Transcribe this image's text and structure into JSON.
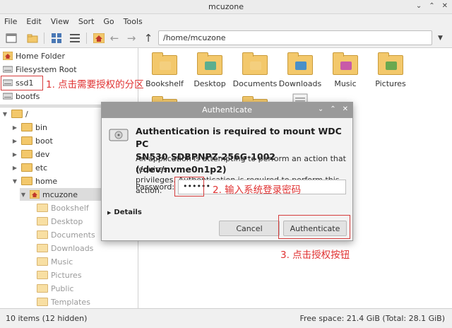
{
  "window": {
    "title": "mcuzone"
  },
  "menu": [
    "File",
    "Edit",
    "View",
    "Sort",
    "Go",
    "Tools"
  ],
  "path": "/home/mcuzone",
  "places": [
    {
      "label": "Home Folder",
      "icon": "home-icon"
    },
    {
      "label": "Filesystem Root",
      "icon": "drive-icon"
    },
    {
      "label": "ssd1",
      "icon": "drive-icon"
    },
    {
      "label": "bootfs",
      "icon": "drive-icon"
    }
  ],
  "tree": [
    {
      "label": "/",
      "level": 0
    },
    {
      "label": "bin",
      "level": 1
    },
    {
      "label": "boot",
      "level": 1
    },
    {
      "label": "dev",
      "level": 1
    },
    {
      "label": "etc",
      "level": 1
    },
    {
      "label": "home",
      "level": 1
    },
    {
      "label": "mcuzone",
      "level": 2
    },
    {
      "label": "Bookshelf",
      "level": 3
    },
    {
      "label": "Desktop",
      "level": 3
    },
    {
      "label": "Documents",
      "level": 3
    },
    {
      "label": "Downloads",
      "level": 3
    },
    {
      "label": "Music",
      "level": 3
    },
    {
      "label": "Pictures",
      "level": 3
    },
    {
      "label": "Public",
      "level": 3
    },
    {
      "label": "Templates",
      "level": 3
    }
  ],
  "files": [
    {
      "label": "Bookshelf",
      "emblem": "#f4cf7e"
    },
    {
      "label": "Desktop",
      "emblem": "#5bae8f"
    },
    {
      "label": "Documents",
      "emblem": "#f4cf7e"
    },
    {
      "label": "Downloads",
      "emblem": "#4a90c8"
    },
    {
      "label": "Music",
      "emblem": "#c85aa8"
    },
    {
      "label": "Pictures",
      "emblem": "#6aa84f"
    }
  ],
  "status": {
    "left": "10 items (12 hidden)",
    "right": "Free space: 21.4 GiB (Total: 28.1 GiB)"
  },
  "dialog": {
    "title": "Authenticate",
    "heading_line1": "Authentication is required to mount WDC PC",
    "heading_line2": "SN530 SDBPNPZ-256G-1002 (/dev/nvme0n1p2)",
    "desc_line1": "An application is attempting to perform an action that requires",
    "desc_line2": "privileges. Authentication is required to perform this action.",
    "password_label": "Password:",
    "password_value": "••••••",
    "details_label": "Details",
    "cancel_label": "Cancel",
    "auth_label": "Authenticate"
  },
  "annotations": {
    "step1": "1. 点击需要授权的分区",
    "step2": "2. 输入系统登录密码",
    "step3": "3. 点击授权按钮",
    "color": "#e03232"
  }
}
